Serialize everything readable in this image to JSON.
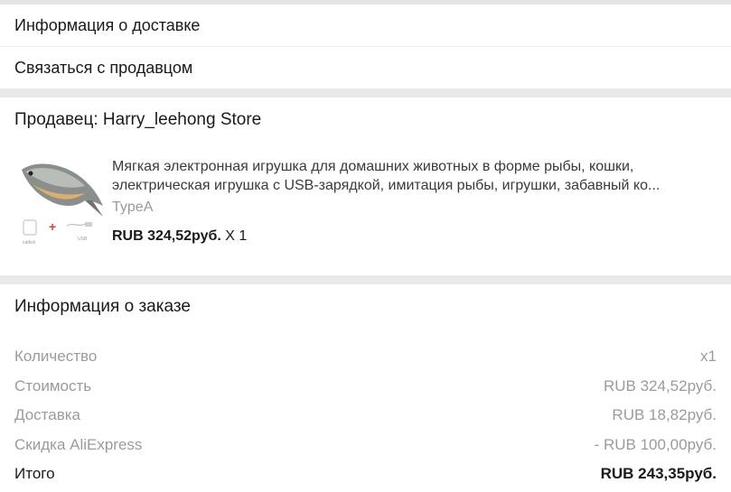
{
  "links": {
    "delivery_info": "Информация о доставке",
    "contact_seller": "Связаться с продавцом"
  },
  "seller": {
    "title": "Продавец: Harry_leehong Store",
    "product": {
      "title": "Мягкая электронная игрушка для домашних животных в форме рыбы, кошки, электрическая игрушка с USB-зарядкой, имитация рыбы, игрушки, забавный ко...",
      "variant": "TypeA",
      "price": "RUB 324,52руб.",
      "quantity": "X 1",
      "thumb_labels": {
        "left": "catfish",
        "right": "USB"
      }
    }
  },
  "order": {
    "title": "Информация о заказе",
    "rows": [
      {
        "label": "Количество",
        "value": "x1"
      },
      {
        "label": "Стоимость",
        "value": "RUB 324,52руб."
      },
      {
        "label": "Доставка",
        "value": "RUB 18,82руб."
      },
      {
        "label": "Скидка AliExpress",
        "value": "- RUB 100,00руб."
      },
      {
        "label": "Итого",
        "value": "RUB 243,35руб."
      }
    ]
  },
  "colors": {
    "page_bg": "#e9e9e9",
    "card_bg": "#ffffff",
    "muted_text": "#9b9b9b",
    "primary_text": "#1a1a1a"
  }
}
